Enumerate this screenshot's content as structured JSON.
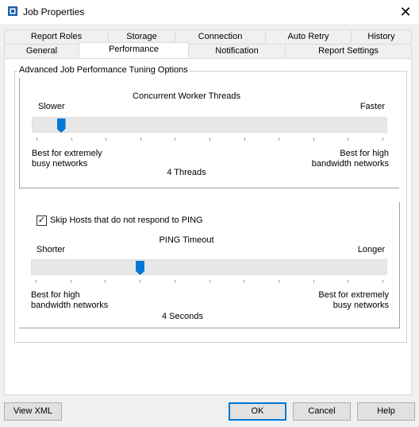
{
  "window": {
    "title": "Job Properties",
    "close_glyph": "✕"
  },
  "tabs_row1": [
    "Report Roles",
    "Storage",
    "Connection",
    "Auto Retry",
    "History"
  ],
  "tabs_row2": [
    "General",
    "Performance",
    "Notification",
    "Report Settings"
  ],
  "active_tab": "Performance",
  "group": {
    "title": "Advanced Job Performance Tuning Options",
    "threads": {
      "heading": "Concurrent Worker Threads",
      "min_label": "Slower",
      "max_label": "Faster",
      "left_hint_line1": "Best for extremely",
      "left_hint_line2": "busy networks",
      "right_hint_line1": "Best for high",
      "right_hint_line2": "bandwidth networks",
      "value_text": "4 Threads",
      "level": 0.07
    },
    "ping": {
      "checkbox_label": "Skip Hosts that do not respond to PING",
      "checked": true,
      "check_glyph": "✓",
      "heading": "PING Timeout",
      "min_label": "Shorter",
      "max_label": "Longer",
      "left_hint_line1": "Best for high",
      "left_hint_line2": "bandwidth networks",
      "right_hint_line1": "Best for extremely",
      "right_hint_line2": "busy networks",
      "value_text": "4 Seconds",
      "level": 0.3
    }
  },
  "buttons": {
    "view_xml": "View XML",
    "ok": "OK",
    "cancel": "Cancel",
    "help": "Help"
  },
  "colors": {
    "accent": "#0078d7",
    "track": "#e7e7e7"
  },
  "icons": {
    "app": "app-icon"
  }
}
